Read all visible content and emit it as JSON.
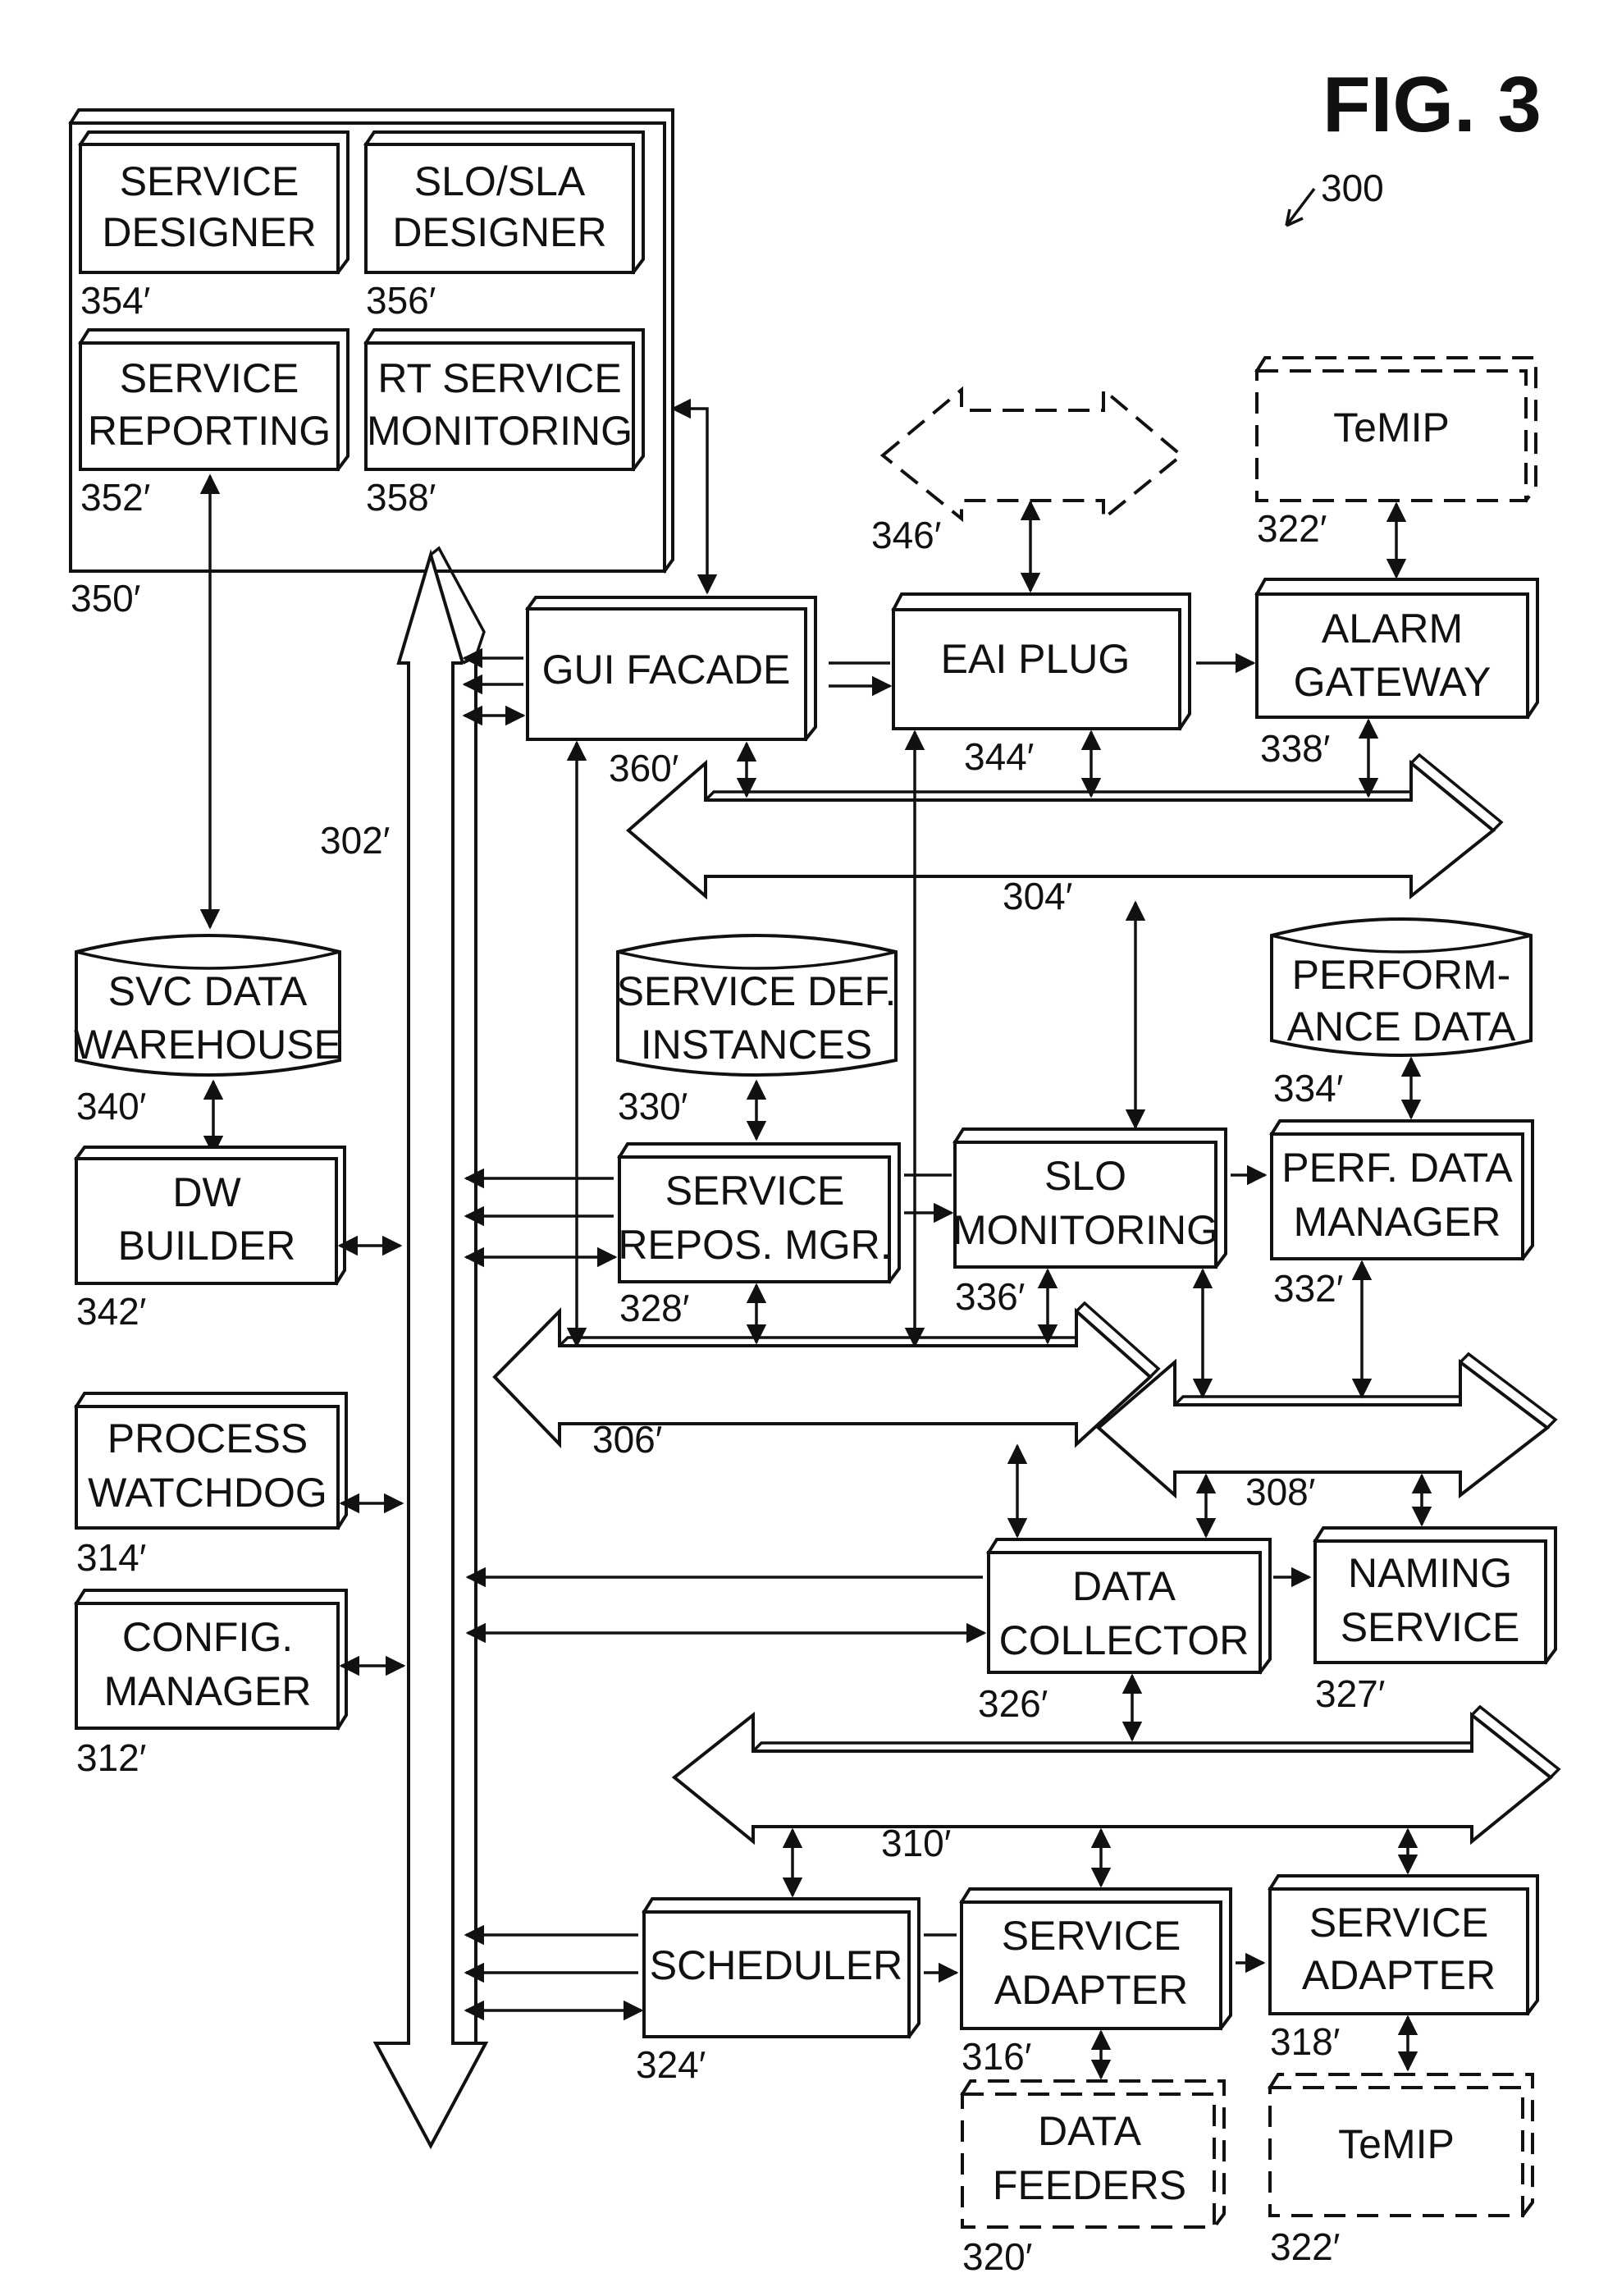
{
  "figure": {
    "title": "FIG. 3",
    "ref": "300"
  },
  "blocks": {
    "service_designer": {
      "lines": [
        "SERVICE",
        "DESIGNER"
      ],
      "ref": "354"
    },
    "slo_sla_designer": {
      "lines": [
        "SLO/SLA",
        "DESIGNER"
      ],
      "ref": "356"
    },
    "service_reporting": {
      "lines": [
        "SERVICE",
        "REPORTING"
      ],
      "ref": "352"
    },
    "rt_service_monitoring": {
      "lines": [
        "RT SERVICE",
        "MONITORING"
      ],
      "ref": "358"
    },
    "ui_group": {
      "ref": "350"
    },
    "gui_facade": {
      "lines": [
        "GUI FACADE"
      ],
      "ref": "360"
    },
    "eai_plug": {
      "lines": [
        "EAI PLUG"
      ],
      "ref": "344"
    },
    "alarm_gateway": {
      "lines": [
        "ALARM",
        "GATEWAY"
      ],
      "ref": "338"
    },
    "temip_top": {
      "lines": [
        "TeMIP"
      ],
      "ref": "322"
    },
    "svc_data_warehouse": {
      "lines": [
        "SVC DATA",
        "WAREHOUSE"
      ],
      "ref": "340"
    },
    "service_def_instances": {
      "lines": [
        "SERVICE DEF.",
        "INSTANCES"
      ],
      "ref": "330"
    },
    "performance_data": {
      "lines": [
        "PERFORM-",
        "ANCE DATA"
      ],
      "ref": "334"
    },
    "dw_builder": {
      "lines": [
        "DW",
        "BUILDER"
      ],
      "ref": "342"
    },
    "service_repos_mgr": {
      "lines": [
        "SERVICE",
        "REPOS. MGR."
      ],
      "ref": "328"
    },
    "slo_monitoring": {
      "lines": [
        "SLO",
        "MONITORING"
      ],
      "ref": "336"
    },
    "perf_data_manager": {
      "lines": [
        "PERF. DATA",
        "MANAGER"
      ],
      "ref": "332"
    },
    "process_watchdog": {
      "lines": [
        "PROCESS",
        "WATCHDOG"
      ],
      "ref": "314"
    },
    "config_manager": {
      "lines": [
        "CONFIG.",
        "MANAGER"
      ],
      "ref": "312"
    },
    "data_collector": {
      "lines": [
        "DATA",
        "COLLECTOR"
      ],
      "ref": "326"
    },
    "naming_service": {
      "lines": [
        "NAMING",
        "SERVICE"
      ],
      "ref": "327"
    },
    "scheduler": {
      "lines": [
        "SCHEDULER"
      ],
      "ref": "324"
    },
    "service_adapter_316": {
      "lines": [
        "SERVICE",
        "ADAPTER"
      ],
      "ref": "316"
    },
    "service_adapter_318": {
      "lines": [
        "SERVICE",
        "ADAPTER"
      ],
      "ref": "318"
    },
    "data_feeders": {
      "lines": [
        "DATA",
        "FEEDERS"
      ],
      "ref": "320"
    },
    "temip_bottom": {
      "lines": [
        "TeMIP"
      ],
      "ref": "322"
    }
  },
  "buses": {
    "bus_302": {
      "ref": "302"
    },
    "bus_304": {
      "ref": "304"
    },
    "bus_306": {
      "ref": "306"
    },
    "bus_308": {
      "ref": "308"
    },
    "bus_310": {
      "ref": "310"
    },
    "bus_346": {
      "ref": "346"
    }
  }
}
